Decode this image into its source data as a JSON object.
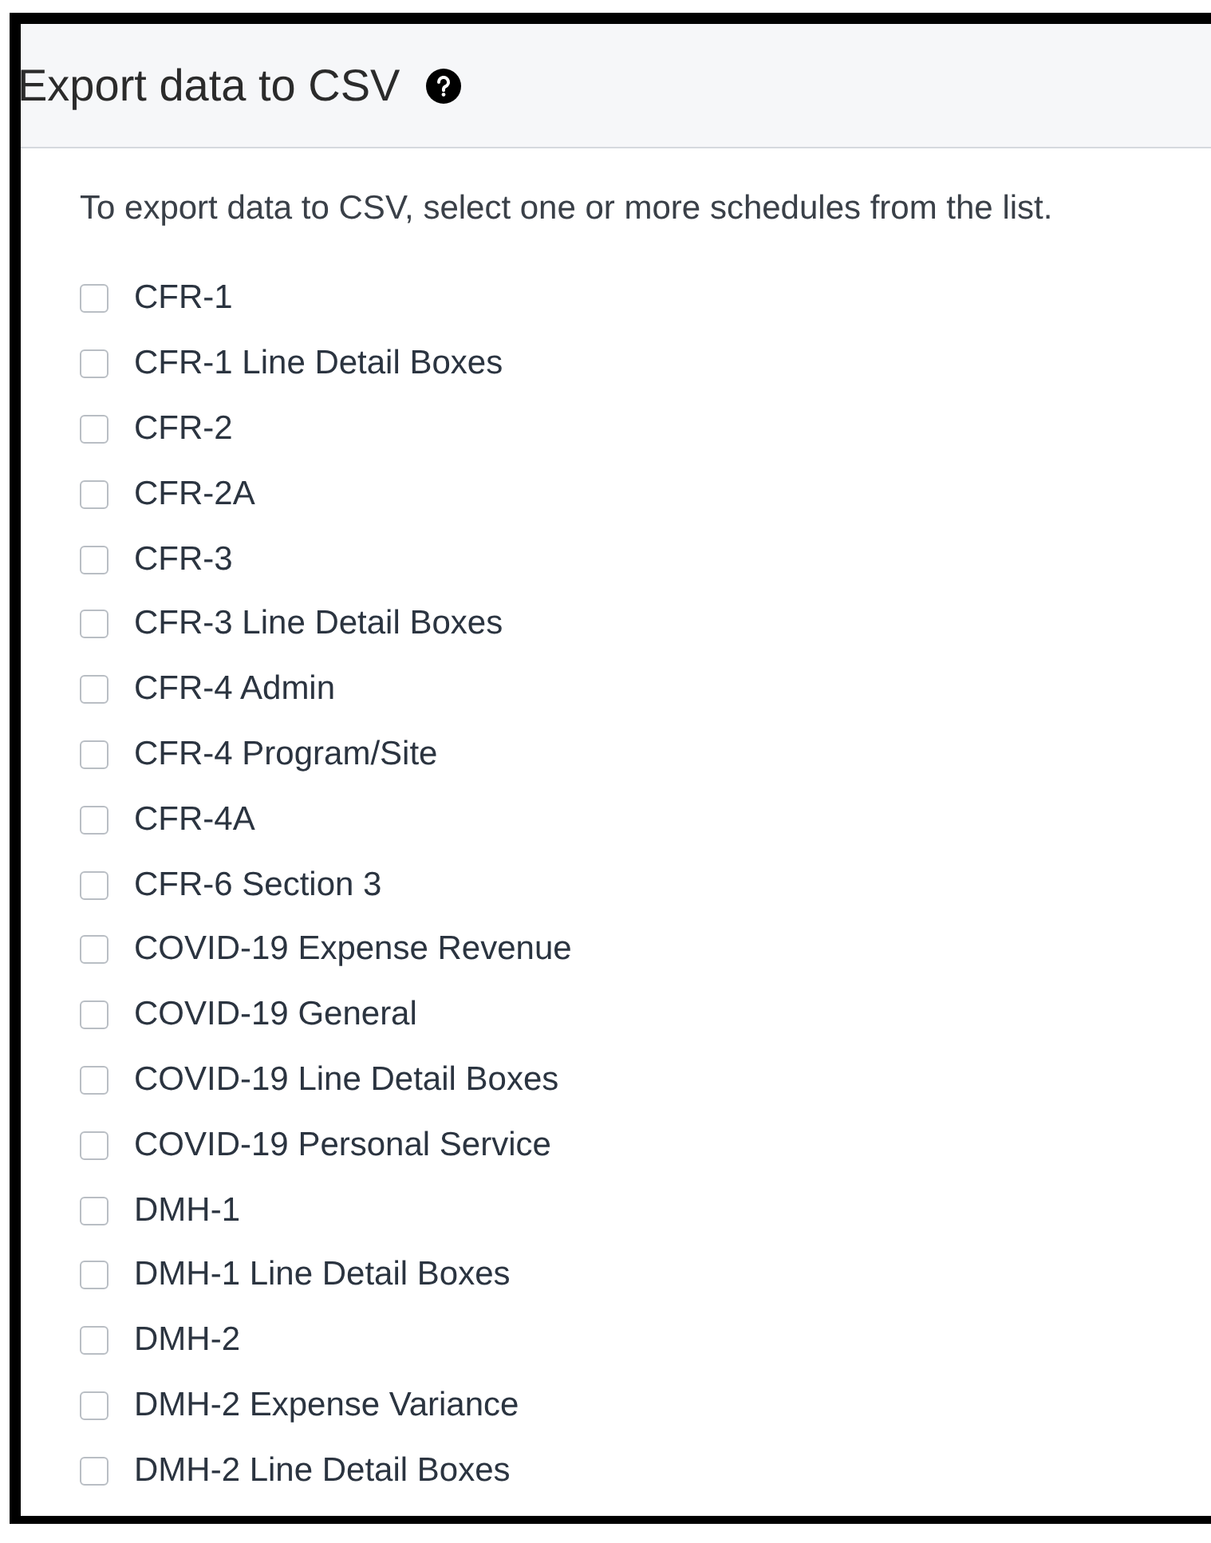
{
  "header": {
    "title": "Export data to CSV"
  },
  "instructions": "To export data to CSV, select one or more schedules from the list.",
  "schedules": [
    {
      "label": "CFR-1",
      "checked": false
    },
    {
      "label": "CFR-1 Line Detail Boxes",
      "checked": false
    },
    {
      "label": "CFR-2",
      "checked": false
    },
    {
      "label": "CFR-2A",
      "checked": false
    },
    {
      "label": "CFR-3",
      "checked": false
    },
    {
      "label": "CFR-3 Line Detail Boxes",
      "checked": false
    },
    {
      "label": "CFR-4 Admin",
      "checked": false
    },
    {
      "label": "CFR-4 Program/Site",
      "checked": false
    },
    {
      "label": "CFR-4A",
      "checked": false
    },
    {
      "label": "CFR-6 Section 3",
      "checked": false
    },
    {
      "label": "COVID-19 Expense Revenue",
      "checked": false
    },
    {
      "label": "COVID-19 General",
      "checked": false
    },
    {
      "label": "COVID-19 Line Detail Boxes",
      "checked": false
    },
    {
      "label": "COVID-19 Personal Service",
      "checked": false
    },
    {
      "label": "DMH-1",
      "checked": false
    },
    {
      "label": "DMH-1 Line Detail Boxes",
      "checked": false
    },
    {
      "label": "DMH-2",
      "checked": false
    },
    {
      "label": "DMH-2 Expense Variance",
      "checked": false
    },
    {
      "label": "DMH-2 Line Detail Boxes",
      "checked": false
    }
  ]
}
